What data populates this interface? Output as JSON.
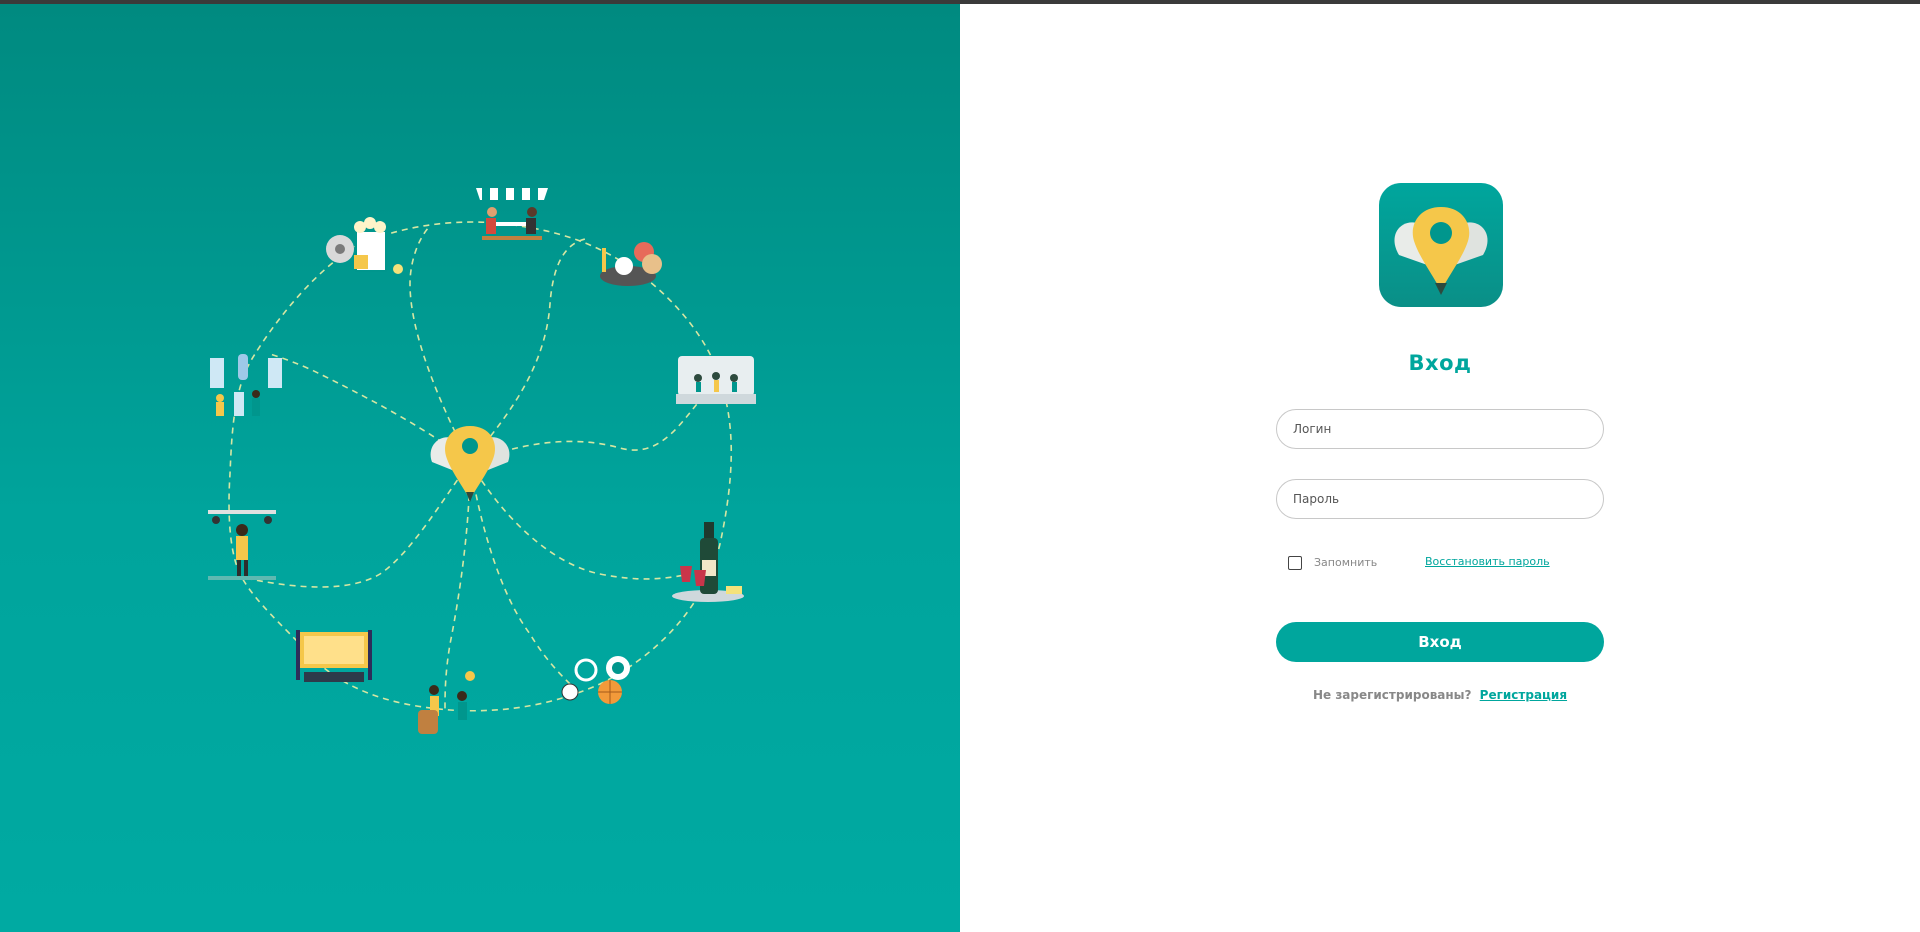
{
  "colors": {
    "brand": "#00a69d",
    "brand_dark": "#008a80",
    "pin": "#f5c74a",
    "path_dash": "#d6e6a3"
  },
  "illustration": {
    "icons": [
      "map-pin-icon",
      "popcorn-cinema-icon",
      "cafe-table-icon",
      "bakery-icon",
      "concert-stage-icon",
      "wine-bottle-icon",
      "sports-balls-icon",
      "street-performers-icon",
      "open-air-cinema-icon",
      "singer-stage-icon",
      "museum-exhibition-icon"
    ]
  },
  "login": {
    "title": "Вход",
    "login_placeholder": "Логин",
    "password_placeholder": "Пароль",
    "remember_label": "Запомнить",
    "restore_link": "Восстановить пароль",
    "submit_label": "Вход",
    "register_question": "Не зарегистрированы?",
    "register_link": "Регистрация"
  }
}
